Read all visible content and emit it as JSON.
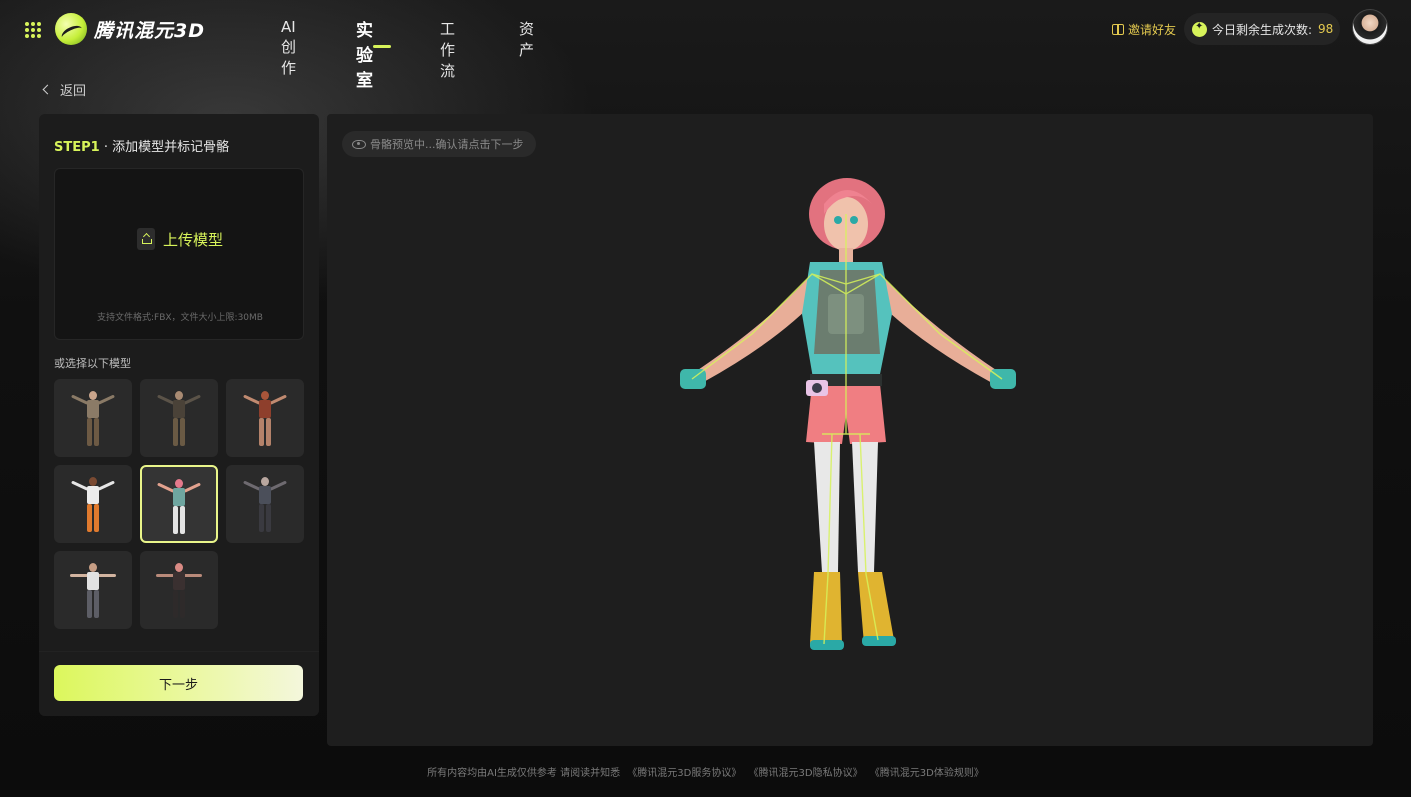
{
  "app": {
    "brand": "腾讯混元3D",
    "icons": {
      "apps": "grid-dots-icon",
      "logo": "hunyuan-logo-icon"
    },
    "accent_color": "#d7f35a"
  },
  "nav": {
    "items": [
      {
        "label": "AI创作",
        "active": false
      },
      {
        "label": "实验室",
        "active": true
      },
      {
        "label": "工作流",
        "active": false
      },
      {
        "label": "资产",
        "active": false
      }
    ]
  },
  "header_right": {
    "invite_label": "邀请好友",
    "quota_label": "今日剩余生成次数:",
    "quota_value": "98",
    "icons": {
      "invite": "gift-icon",
      "quota": "sparkle-icon",
      "avatar": "user-avatar"
    }
  },
  "back": {
    "label": "返回",
    "icon": "chevron-left-icon"
  },
  "left_panel": {
    "step_prefix": "STEP1",
    "step_separator": "·",
    "step_title": "添加模型并标记骨骼",
    "upload": {
      "button_label": "上传模型",
      "hint": "支持文件格式:FBX，文件大小上限:30MB",
      "icon": "upload-icon"
    },
    "choose_label": "或选择以下模型",
    "models": [
      {
        "id": 1,
        "selected": false
      },
      {
        "id": 2,
        "selected": false
      },
      {
        "id": 3,
        "selected": false
      },
      {
        "id": 4,
        "selected": false
      },
      {
        "id": 5,
        "selected": true
      },
      {
        "id": 6,
        "selected": false
      },
      {
        "id": 7,
        "selected": false
      },
      {
        "id": 8,
        "selected": false
      }
    ],
    "next_button": "下一步"
  },
  "viewport": {
    "preview_hint": "骨骼预览中...确认请点击下一步",
    "icon": "eye-icon"
  },
  "footer": {
    "disclaimer": "所有内容均由AI生成仅供参考 请阅读并知悉",
    "links": [
      "《腾讯混元3D服务协议》",
      "《腾讯混元3D隐私协议》",
      "《腾讯混元3D体验规则》"
    ]
  }
}
